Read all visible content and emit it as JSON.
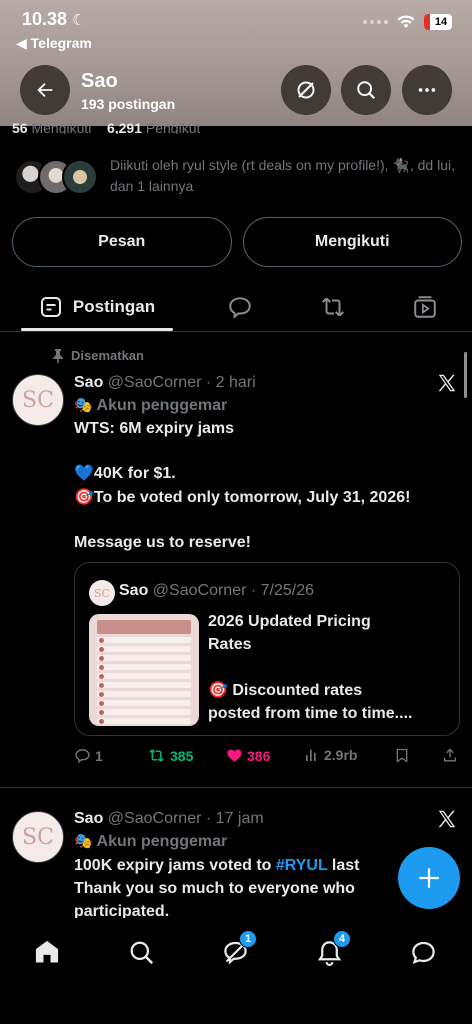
{
  "status_bar": {
    "time": "10.38",
    "back_app": "◀ Telegram",
    "battery": "14"
  },
  "header": {
    "title": "Sao",
    "subtitle": "193 postingan"
  },
  "profile": {
    "following_count": "56",
    "following_label": "Mengikuti",
    "followers_count": "6,291",
    "followers_label": "Pengikut",
    "followed_by": "Diikuti oleh ryul style (rt deals on my profile!), 🐈‍⬛, dd lui, dan 1 lainnya",
    "message_button": "Pesan",
    "following_button": "Mengikuti"
  },
  "tabs": {
    "posts_label": "Postingan"
  },
  "tweet1": {
    "pinned_label": "Disematkan",
    "avatar_text": "SC",
    "name": "Sao",
    "handle": "@SaoCorner",
    "time": "· 2 hari",
    "fan_label": "Akun penggemar",
    "line1": "WTS: 6M expiry jams",
    "line2": "💙40K for $1.",
    "line3": "🎯To be voted only tomorrow, July 31, 2026!",
    "line4": "Message us to reserve!",
    "quote": {
      "avatar_text": "SC",
      "name": "Sao",
      "handle": "@SaoCorner",
      "time": "· 7/25/26",
      "title_line1": "2026 Updated Pricing",
      "title_line2": "Rates",
      "body_line1": "🎯 Discounted rates",
      "body_line2": "posted from time to time...."
    },
    "replies": "1",
    "reposts": "385",
    "likes": "386",
    "views": "2.9rb"
  },
  "tweet2": {
    "avatar_text": "SC",
    "name": "Sao",
    "handle": "@SaoCorner",
    "time": "· 17 jam",
    "fan_label": "Akun penggemar",
    "line1_pre": "100K expiry jams voted to ",
    "line1_tag": "#RYUL",
    "line1_post": " last",
    "line2": "Thank you so much to everyone who",
    "line3": "participated."
  },
  "bottom_nav": {
    "grok_badge": "1",
    "notif_badge": "4"
  },
  "colors": {
    "accent": "#1d9bf0",
    "repost": "#00ba7c",
    "like": "#f91880"
  }
}
